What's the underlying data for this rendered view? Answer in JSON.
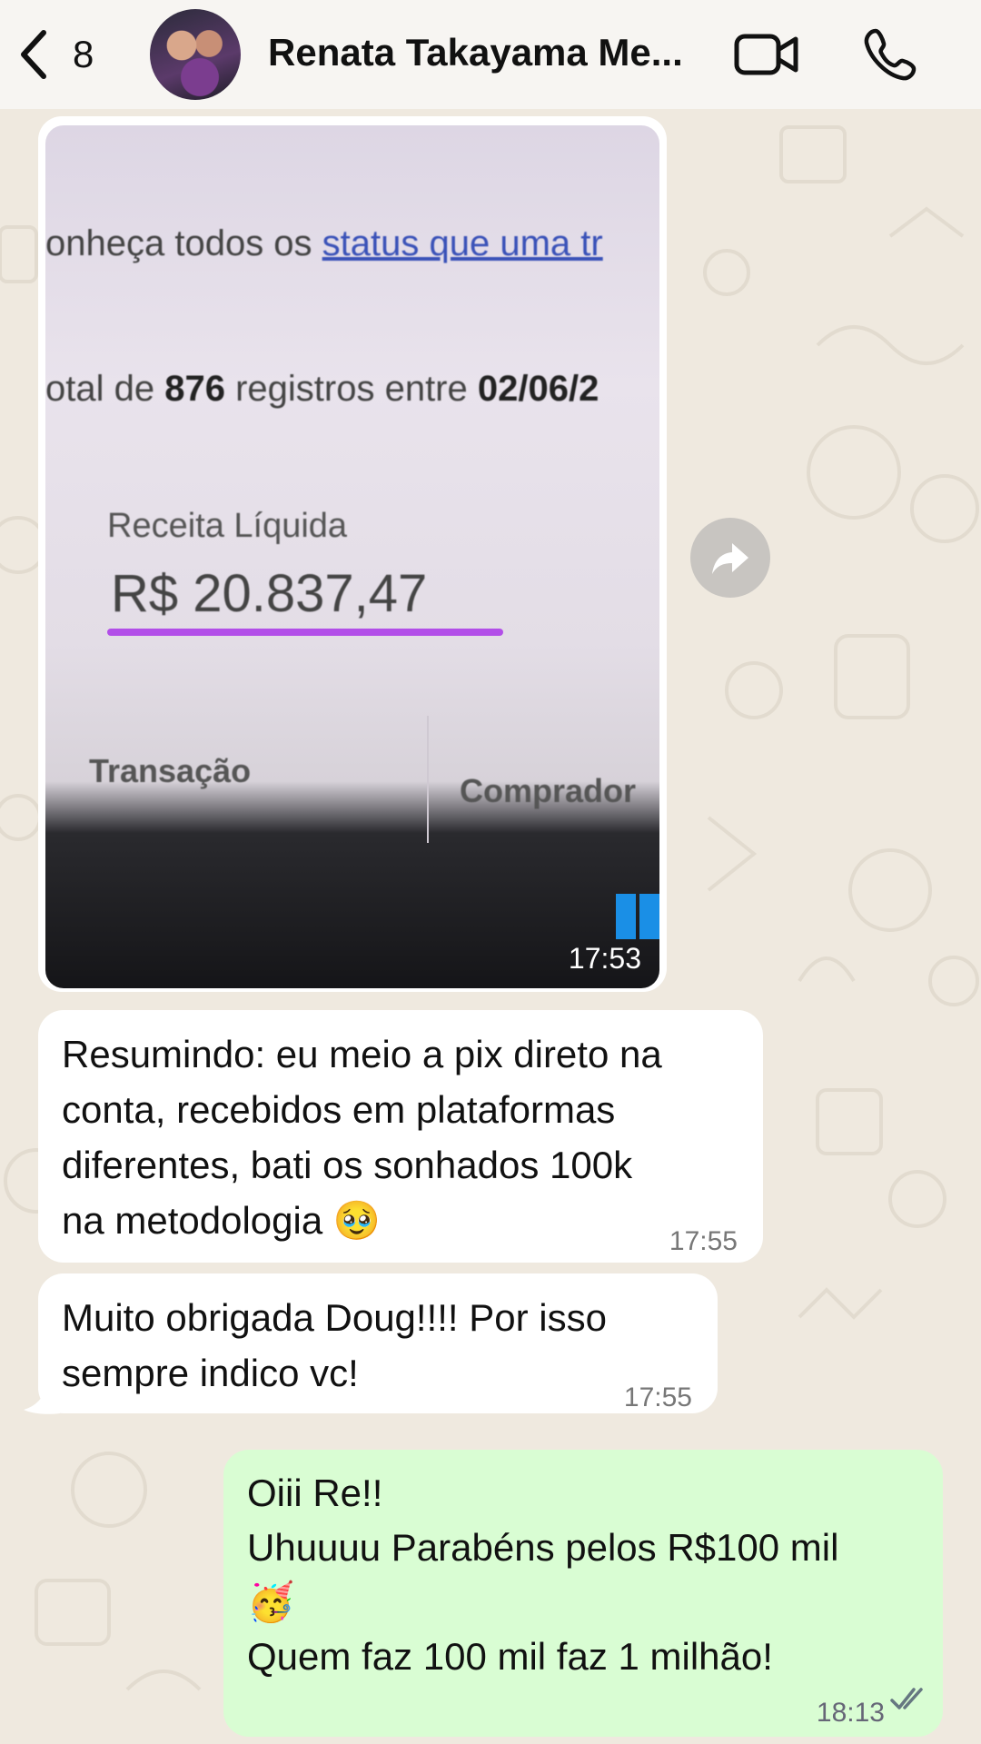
{
  "header": {
    "unread_count": "8",
    "contact_name": "Renata Takayama Me..."
  },
  "messages": {
    "image": {
      "line1_prefix": "onheça todos os ",
      "line1_link": "status que uma tr",
      "line2_a": "otal de ",
      "line2_b": "876",
      "line2_c": " registros entre ",
      "line2_d": "02/06/2",
      "label": "Receita Líquida",
      "amount": "R$ 20.837,47",
      "col1": "Transação",
      "col2": "Comprador",
      "time": "17:53"
    },
    "m1": {
      "text": "Resumindo: eu meio a pix direto na\nconta, recebidos em plataformas\ndiferentes, bati os sonhados 100k\nna metodologia 🥹",
      "time": "17:55"
    },
    "m2": {
      "text": "Muito obrigada Doug!!!! Por isso\nsempre indico vc!",
      "time": "17:55"
    },
    "m3": {
      "line1": "Oiii Re!!",
      "line2": "Uhuuuu Parabéns pelos R$100 mil",
      "line3": "🥳",
      "line4": "Quem faz 100 mil faz 1 milhão!",
      "time": "18:13"
    }
  },
  "colors": {
    "outgoing_bubble": "#d9fdd3",
    "incoming_bubble": "#ffffff",
    "wallpaper": "#efe9df",
    "read_ticks": "#667781"
  },
  "icons": [
    "chevron-left-icon",
    "video-camera-icon",
    "phone-icon",
    "forward-share-icon",
    "double-check-icon"
  ]
}
